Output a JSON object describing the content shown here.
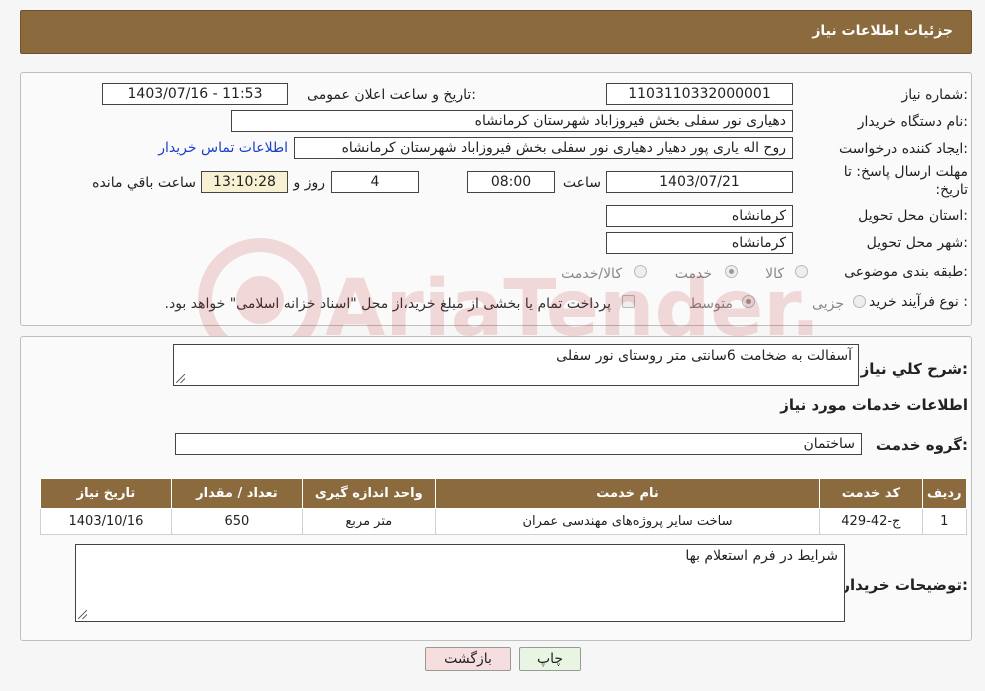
{
  "header": {
    "title": "جزئیات اطلاعات نیاز"
  },
  "details": {
    "need_number_label": "شماره نیاز:",
    "need_number": "1103110332000001",
    "announce_label": "تاریخ و ساعت اعلان عمومی:",
    "announce_value": "1403/07/16 - 11:53",
    "buyer_label": "نام دستگاه خریدار:",
    "buyer_value": "دهیاری نور سفلی بخش فیروزاباد  شهرستان کرمانشاه",
    "creator_label": "ایجاد کننده درخواست:",
    "creator_value": "روح اله یاری پور دهیار دهیاری نور سفلی بخش فیروزاباد  شهرستان کرمانشاه",
    "contact_link": "اطلاعات تماس خریدار",
    "deadline_label": "مهلت ارسال پاسخ: تا تاریخ:",
    "deadline_date": "1403/07/21",
    "time_label": "ساعت",
    "deadline_time": "08:00",
    "days_value": "4",
    "days_label": "روز و",
    "remaining_time": "13:10:28",
    "remaining_label": "ساعت باقي مانده",
    "province_label": "استان محل تحویل:",
    "province_value": "کرمانشاه",
    "city_label": "شهر محل تحویل:",
    "city_value": "کرمانشاه",
    "category_label": "طبقه بندی موضوعی:",
    "category_options": [
      "کالا",
      "خدمت",
      "کالا/خدمت"
    ],
    "category_selected": "خدمت",
    "process_label": "نوع فرآیند خرید :",
    "process_options": [
      "جزیی",
      "متوسط"
    ],
    "payment_note": "پرداخت تمام یا بخشی از مبلغ خرید،از محل \"اسناد خزانه اسلامی\" خواهد بود."
  },
  "summary": {
    "label": "شرح كلي نياز:",
    "value": "آسفالت به ضخامت 6سانتی متر روستای نور سفلی"
  },
  "services": {
    "section_title": "اطلاعات خدمات مورد نياز",
    "group_label": "گروه خدمت:",
    "group_value": "ساختمان",
    "columns": [
      "ردیف",
      "کد خدمت",
      "نام خدمت",
      "واحد اندازه گیری",
      "تعداد / مقدار",
      "تاریخ نیاز"
    ],
    "rows": [
      [
        "1",
        "ج-42-429",
        "ساخت سایر پروژه‌های مهندسی عمران",
        "متر مربع",
        "650",
        "1403/10/16"
      ]
    ]
  },
  "buyer_notes": {
    "label": "توضیحات خریدار:",
    "value": "شرایط در فرم استعلام بها"
  },
  "buttons": {
    "print": "چاپ",
    "back": "بازگشت"
  },
  "watermark_text": "AriaTender.neT",
  "colors": {
    "header_bg": "#8b6a3e",
    "link": "#1a3fc9",
    "back_button": "#f6dede",
    "print_button": "#e8f5e2"
  }
}
